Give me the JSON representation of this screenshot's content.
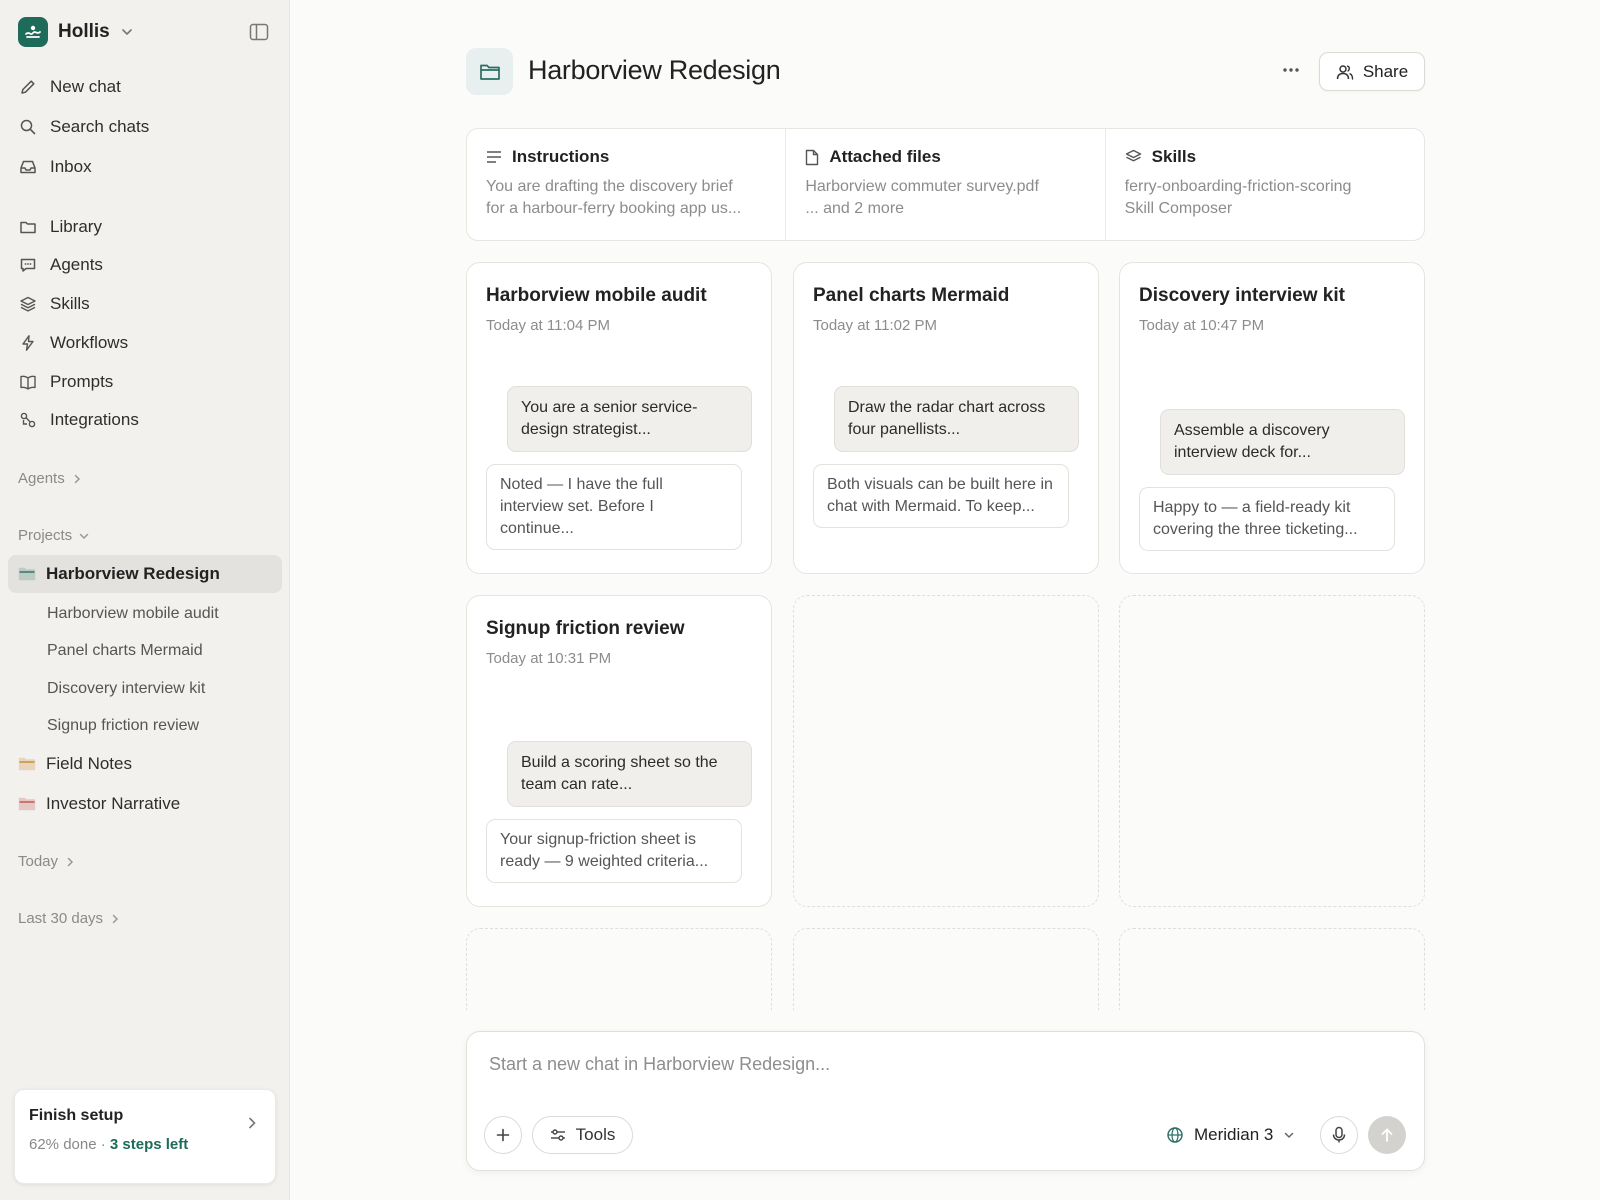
{
  "brand": {
    "name": "Hollis",
    "logo_color": "#1f6b5a"
  },
  "nav": {
    "new_chat": "New chat",
    "search_chats": "Search chats",
    "inbox": "Inbox",
    "library": "Library",
    "agents": "Agents",
    "skills": "Skills",
    "workflows": "Workflows",
    "prompts": "Prompts",
    "integrations": "Integrations"
  },
  "sections": {
    "agents": "Agents",
    "projects": "Projects",
    "today": "Today",
    "last30": "Last 30 days"
  },
  "projects": {
    "active": "Harborview Redesign",
    "active_children": [
      "Harborview mobile audit",
      "Panel charts Mermaid",
      "Discovery interview kit",
      "Signup friction review"
    ],
    "field_notes": "Field Notes",
    "investor_narrative": "Investor Narrative",
    "folder_colors": {
      "active": "#2a6d63",
      "field_notes": "#c98a2e",
      "investor_narrative": "#c0504d"
    }
  },
  "setup": {
    "title": "Finish setup",
    "progress_text": "62% done",
    "separator": " · ",
    "steps_left": "3 steps left",
    "progress": 0.62
  },
  "header": {
    "title": "Harborview Redesign",
    "share_label": "Share"
  },
  "info": {
    "instructions": {
      "title": "Instructions",
      "line1": "You are drafting the discovery brief",
      "line2": "for a harbour-ferry booking app us..."
    },
    "files": {
      "title": "Attached files",
      "line1": "Harborview commuter survey.pdf",
      "line2": "... and 2 more"
    },
    "skills": {
      "title": "Skills",
      "line1": "ferry-onboarding-friction-scoring",
      "line2": "Skill Composer"
    }
  },
  "chats": [
    {
      "title": "Harborview mobile audit",
      "time": "Today at 11:04 PM",
      "user": "You are a senior service-design strategist...",
      "reply": "Noted — I have the full interview set. Before I continue..."
    },
    {
      "title": "Panel charts Mermaid",
      "time": "Today at 11:02 PM",
      "user": "Draw the radar chart across four panellists...",
      "reply": "Both visuals can be built here in chat with Mermaid. To keep..."
    },
    {
      "title": "Discovery interview kit",
      "time": "Today at 10:47 PM",
      "user": "Assemble a discovery interview deck for...",
      "reply": "Happy to — a field-ready kit covering the three ticketing..."
    },
    {
      "title": "Signup friction review",
      "time": "Today at 10:31 PM",
      "user": "Build a scoring sheet so the team can rate...",
      "reply": "Your signup-friction sheet is ready — 9 weighted criteria..."
    }
  ],
  "composer": {
    "placeholder": "Start a new chat in Harborview Redesign...",
    "tools_label": "Tools",
    "model_label": "Meridian 3"
  }
}
